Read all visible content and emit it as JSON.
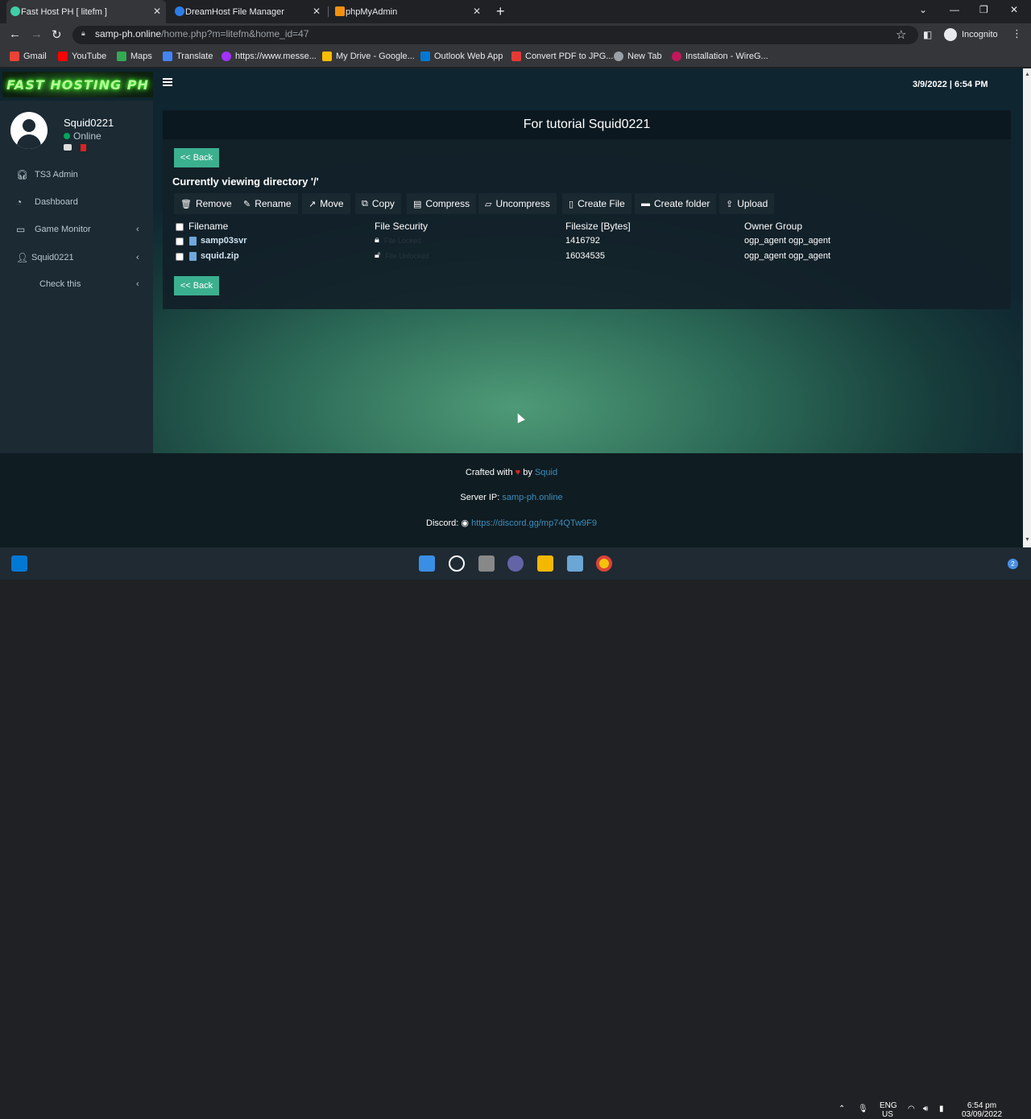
{
  "browser": {
    "tabs": [
      {
        "title": "Fast Host PH [ litefm ]",
        "active": true,
        "favicon_color": "#3ecfa8"
      },
      {
        "title": "DreamHost File Manager",
        "active": false,
        "favicon_color": "#2b7de9"
      },
      {
        "title": "phpMyAdmin",
        "active": false,
        "favicon_color": "#f29111"
      }
    ],
    "url_host": "samp-ph.online",
    "url_rest": "/home.php?m=litefm&home_id=47",
    "profile": "Incognito",
    "bookmarks": [
      {
        "label": "Gmail",
        "color": "#ea4335"
      },
      {
        "label": "YouTube",
        "color": "#ff0000"
      },
      {
        "label": "Maps",
        "color": "#34a853"
      },
      {
        "label": "Translate",
        "color": "#4285f4"
      },
      {
        "label": "https://www.messe...",
        "color": "#a033ff"
      },
      {
        "label": "My Drive - Google...",
        "color": "#fbbc04"
      },
      {
        "label": "Outlook Web App",
        "color": "#0078d4"
      },
      {
        "label": "Convert PDF to JPG...",
        "color": "#e53935"
      },
      {
        "label": "New Tab",
        "color": "#9aa0a6"
      },
      {
        "label": "Installation - WireG...",
        "color": "#c2185b"
      }
    ]
  },
  "header": {
    "logo_text": "FAST HOSTING PH",
    "datetime": "3/9/2022 | 6:54 PM"
  },
  "user": {
    "name": "Squid0221",
    "status": "Online"
  },
  "sidebar": {
    "items": [
      {
        "label": "TS3 Admin",
        "icon": "headset-icon",
        "chevron": false
      },
      {
        "label": "Dashboard",
        "icon": "dashboard-icon",
        "chevron": false
      },
      {
        "label": "Game Monitor",
        "icon": "laptop-icon",
        "chevron": true
      },
      {
        "label": "Squid0221",
        "icon": "user-icon",
        "chevron": true
      },
      {
        "label": "Check this",
        "icon": "",
        "chevron": true
      }
    ]
  },
  "filemanager": {
    "title": "For tutorial Squid0221",
    "back_label": "<< Back",
    "directory_label": "Currently viewing directory '/'",
    "toolbar": [
      {
        "label": "Remove",
        "icon": "trash-icon"
      },
      {
        "label": "Rename",
        "icon": "edit-icon"
      },
      {
        "label": "Move",
        "icon": "move-icon"
      },
      {
        "label": "Copy",
        "icon": "copy-icon"
      },
      {
        "label": "Compress",
        "icon": "compress-icon"
      },
      {
        "label": "Uncompress",
        "icon": "folder-open-icon"
      },
      {
        "label": "Create File",
        "icon": "file-icon"
      },
      {
        "label": "Create folder",
        "icon": "folder-icon"
      },
      {
        "label": "Upload",
        "icon": "upload-icon"
      }
    ],
    "columns": [
      "Filename",
      "File Security",
      "Filesize [Bytes]",
      "Owner Group"
    ],
    "rows": [
      {
        "filename": "samp03svr",
        "security": "File Locked",
        "size": "1416792",
        "owner": "ogp_agent ogp_agent"
      },
      {
        "filename": "squid.zip",
        "security": "File Unlocked",
        "size": "16034535",
        "owner": "ogp_agent ogp_agent"
      }
    ]
  },
  "footer": {
    "crafted_prefix": "Crafted with",
    "crafted_by": "by",
    "crafted_author": "Squid",
    "server_ip_label": "Server IP:",
    "server_ip": "samp-ph.online",
    "discord_label": "Discord:",
    "discord_link": "https://discord.gg/mp74QTw9F9"
  },
  "taskbar": {
    "lang_top": "ENG",
    "lang_bottom": "US",
    "time": "6:54 pm",
    "date": "03/09/2022",
    "notifications": "2"
  }
}
